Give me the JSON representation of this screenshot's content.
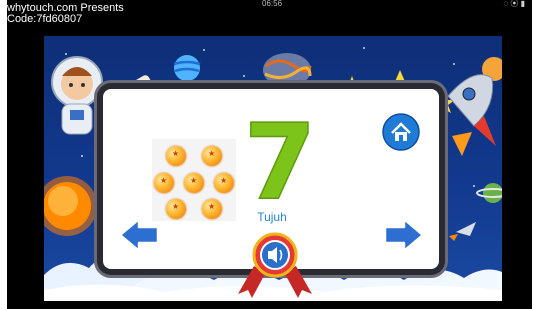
{
  "status_bar": {
    "time": "06:56",
    "icons": "◌ ⦿ ▮"
  },
  "watermark": {
    "line1": "whytouch.com Presents",
    "line2": "Code:7fd60807"
  },
  "lesson": {
    "number": "7",
    "word": "Tujuh",
    "item_count": 7
  },
  "icons": {
    "home": "home-icon",
    "prev": "arrow-left-icon",
    "next": "arrow-right-icon",
    "sound": "speaker-icon"
  },
  "colors": {
    "scene_bg": "#12398e",
    "number_green": "#8fd11d",
    "word_blue": "#2f86c8",
    "arrow_blue": "#2d6fd0",
    "ribbon_red": "#c62828",
    "sun": "#ff8a00"
  }
}
